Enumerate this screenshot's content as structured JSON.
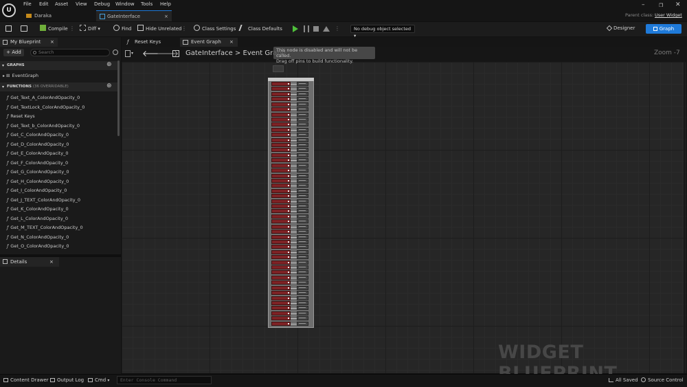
{
  "menu": [
    "File",
    "Edit",
    "Asset",
    "View",
    "Debug",
    "Window",
    "Tools",
    "Help"
  ],
  "logo_text": "U",
  "doc_tabs": [
    {
      "label": "Daraka",
      "icon": "folder-icon"
    },
    {
      "label": "GateInterface",
      "icon": "widget-blueprint-icon",
      "close": "×"
    }
  ],
  "parent_class": {
    "label": "Parent class:",
    "value": "User Widget"
  },
  "window_controls": {
    "minimize": "–",
    "maximize": "❐",
    "close": "✕"
  },
  "toolbar": {
    "compile": "Compile",
    "diff": "Diff",
    "find": "Find",
    "hide_unrelated": "Hide Unrelated",
    "class_settings": "Class Settings",
    "class_defaults": "Class Defaults",
    "debug_object": "No debug object selected",
    "designer": "Designer",
    "graph": "Graph",
    "more": "⋮",
    "chevron": "▾"
  },
  "my_blueprint": {
    "tab": "My Blueprint",
    "close": "×",
    "add": "+ Add",
    "search_placeholder": "Search",
    "sections": {
      "graphs": "GRAPHS",
      "functions": "FUNCTIONS",
      "functions_count": "(36 OVERRIDABLE)"
    },
    "graphs": [
      "EventGraph"
    ],
    "functions": [
      "Get_Text_A_ColorAndOpacity_0",
      "Get_TextLock_ColorAndOpacity_0",
      "Reset Keys",
      "Get_Text_b_ColorAndOpacity_0",
      "Get_C_ColorAndOpacity_0",
      "Get_D_ColorAndOpacity_0",
      "Get_E_ColorAndOpacity_0",
      "Get_F_ColorAndOpacity_0",
      "Get_G_ColorAndOpacity_0",
      "Get_H_ColorAndOpacity_0",
      "Get_I_ColorAndOpacity_0",
      "Get_J_TEXT_ColorAndOpacity_0",
      "Get_K_ColorAndOpacity_0",
      "Get_L_ColorAndOpacity_0",
      "Get_M_TEXT_ColorAndOpacity_0",
      "Get_N_ColorAndOpacity_0",
      "Get_O_ColorAndOpacity_0"
    ]
  },
  "details": {
    "tab": "Details",
    "close": "×"
  },
  "graph_tabs": [
    {
      "label": "Reset Keys",
      "icon": "function-icon"
    },
    {
      "label": "Event Graph",
      "icon": "event-graph-icon",
      "close": "×"
    }
  ],
  "breadcrumb": {
    "root": "GateInterface",
    "sep": ">",
    "current": "Event Graph"
  },
  "zoom": "Zoom -7",
  "comment_note": {
    "line1": "This node is disabled and will not be called.",
    "line2": "Drag off pins to build functionality."
  },
  "watermark": "WIDGET BLUEPRINT",
  "node_row_count": 48,
  "status": {
    "content_drawer": "Content Drawer",
    "output_log": "Output Log",
    "cmd": "Cmd",
    "console_placeholder": "Enter Console Command",
    "all_saved": "All Saved",
    "source_control": "Source Control"
  },
  "colors": {
    "accent": "#1f7ad9",
    "node_pin_red": "#7e2225",
    "graph_bg": "#262626"
  }
}
